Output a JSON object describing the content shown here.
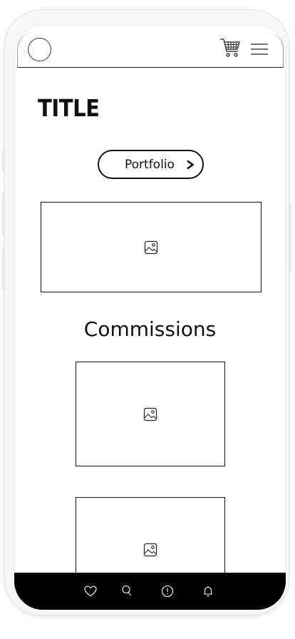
{
  "header": {
    "avatar_icon": "avatar-circle",
    "cart_icon": "shopping-cart-icon",
    "menu_icon": "hamburger-menu-icon"
  },
  "main": {
    "title": "TITLE",
    "portfolio_button": {
      "label": "Portfolio",
      "icon": "chevron-right-icon"
    },
    "hero_image": {
      "icon": "image-placeholder-icon"
    },
    "commissions": {
      "title": "Commissions",
      "items": [
        {
          "icon": "image-placeholder-icon"
        },
        {
          "icon": "image-placeholder-icon"
        }
      ]
    }
  },
  "bottom_nav": {
    "items": [
      {
        "icon": "heart-icon"
      },
      {
        "icon": "search-icon"
      },
      {
        "icon": "alert-circle-icon"
      },
      {
        "icon": "bell-icon"
      }
    ]
  },
  "colors": {
    "nav_background": "#000000",
    "ink": "#111111",
    "frame": "#f7f7f7"
  }
}
